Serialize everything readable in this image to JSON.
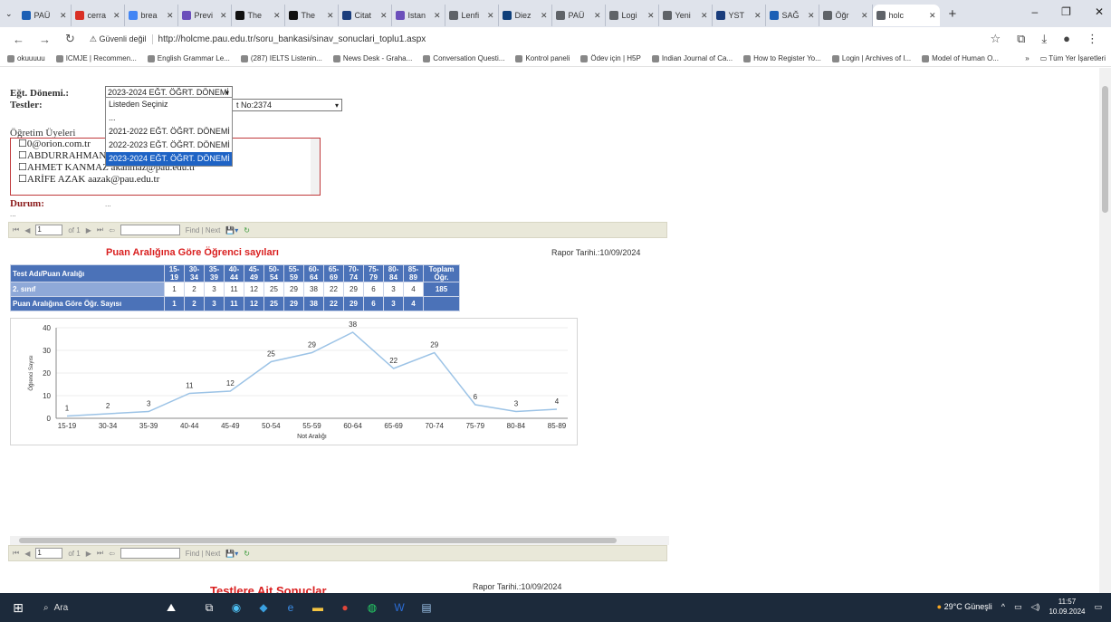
{
  "browser": {
    "tabs": [
      {
        "label": "PAÜ",
        "color": "#1b5fb5"
      },
      {
        "label": "cerra",
        "color": "#d93025"
      },
      {
        "label": "brea",
        "color": "#4285f4"
      },
      {
        "label": "Previ",
        "color": "#6b4fbb"
      },
      {
        "label": "The",
        "color": "#111111"
      },
      {
        "label": "The",
        "color": "#111111"
      },
      {
        "label": "Citat",
        "color": "#1a3d7c"
      },
      {
        "label": "Istan",
        "color": "#6b4fbb"
      },
      {
        "label": "Lenfi",
        "color": "#5f6368"
      },
      {
        "label": "Diez",
        "color": "#0f3f7a"
      },
      {
        "label": "PAÜ",
        "color": "#5f6368"
      },
      {
        "label": "Logi",
        "color": "#5f6368"
      },
      {
        "label": "Yeni",
        "color": "#5f6368"
      },
      {
        "label": "YST",
        "color": "#1a3d7c"
      },
      {
        "label": "SAĞ",
        "color": "#1b5fb5"
      },
      {
        "label": "Öğr",
        "color": "#5f6368"
      },
      {
        "label": "holc",
        "color": "#5f6368",
        "active": true
      }
    ],
    "new_tab": "+",
    "window_controls": [
      "–",
      "❐",
      "✕"
    ],
    "security_label": "Güvenli değil",
    "url": "http://holcme.pau.edu.tr/soru_bankasi/sinav_sonuclari_toplu1.aspx",
    "bookmarks": [
      "okuuuuu",
      "ICMJE | Recommen...",
      "English Grammar Le...",
      "(287) IELTS Listenin...",
      "News Desk - Graha...",
      "Conversation Questi...",
      "Kontrol paneli",
      "Ödev için | H5P",
      "Indian Journal of Ca...",
      "How to Register Yo...",
      "Login | Archives of I...",
      "Model of Human O..."
    ],
    "bookmarks_more": "»",
    "all_bookmarks": "Tüm Yer İşaretleri"
  },
  "form": {
    "term_label": "Eğt. Dönemi.:",
    "term_value": "2023-2024 EĞT. ÖĞRT. DÖNEMİ",
    "tests_label": "Testler:",
    "tests_value_tail": "t No:2374",
    "dropdown_options": [
      "Listeden Seçiniz",
      "...",
      "2021-2022 EĞT. ÖĞRT. DÖNEMİ",
      "2022-2023 EĞT. ÖĞRT. DÖNEMİ",
      "2023-2024 EĞT. ÖĞRT. DÖNEMİ"
    ],
    "members_label": "Öğretim Üyeleri",
    "members": [
      "0@orion.com.tr",
      "ABDURRAHMAN Ş",
      "AHMET KANMAZ akanmaz@pau.edu.tr",
      "ARİFE AZAK aazak@pau.edu.tr"
    ],
    "status_label": "Durum:",
    "status_value": "...",
    "dots": "..."
  },
  "toolbar": {
    "page_input": "1",
    "of_label": "of 1",
    "find_label": "Find | Next"
  },
  "report": {
    "title": "Puan Aralığına Göre Öğrenci sayıları",
    "date": "Rapor Tarihi.:10/09/2024",
    "header_test": "Test Adı/Puan Aralığı",
    "header_total": "Toplam Öğr.",
    "row1_label": "2. sınıf",
    "row2_label": "Puan  Aralığına Göre Öğr. Sayısı",
    "total": "185"
  },
  "chart_data": {
    "type": "line",
    "categories": [
      "15-19",
      "30-34",
      "35-39",
      "40-44",
      "45-49",
      "50-54",
      "55-59",
      "60-64",
      "65-69",
      "70-74",
      "75-79",
      "80-84",
      "85-89"
    ],
    "values": [
      1,
      2,
      3,
      11,
      12,
      25,
      29,
      38,
      22,
      29,
      6,
      3,
      4
    ],
    "xlabel": "Not Aralığı",
    "ylabel": "Öğrenci Sayısı",
    "ylim": [
      0,
      40
    ],
    "yticks": [
      0,
      10,
      20,
      30,
      40
    ],
    "line_color": "#9cc3e6"
  },
  "report2": {
    "title": "Testlere Ait Sonuçlar",
    "date": "Rapor Tarihi.:10/09/2024"
  },
  "taskbar": {
    "search_placeholder": "Ara",
    "weather": "29°C  Güneşli",
    "time": "11:57",
    "date": "10.09.2024"
  }
}
